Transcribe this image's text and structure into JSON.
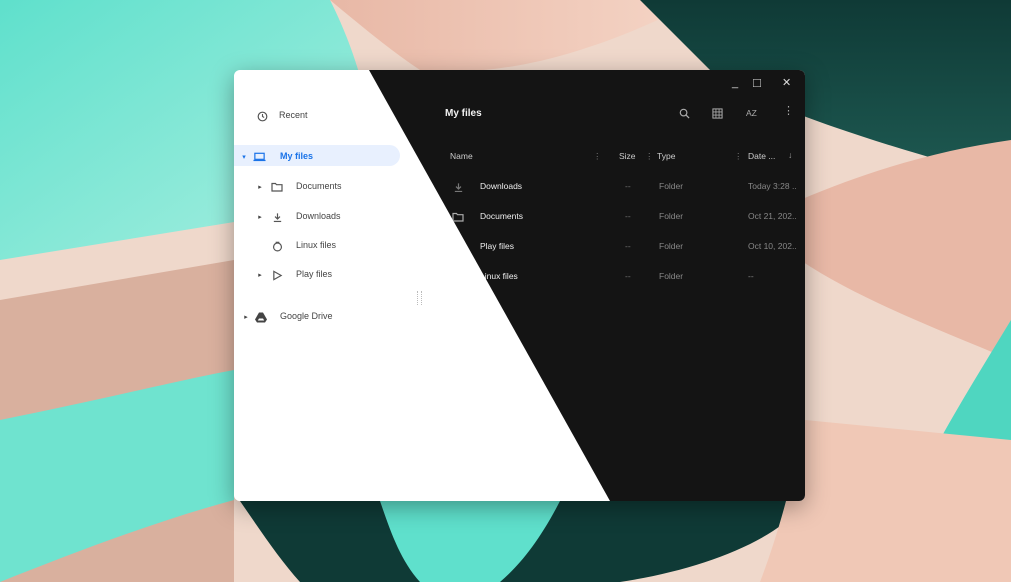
{
  "sidebar": {
    "recent": "Recent",
    "my_files": "My files",
    "documents": "Documents",
    "downloads": "Downloads",
    "linux_files": "Linux files",
    "play_files": "Play files",
    "google_drive": "Google Drive"
  },
  "main": {
    "title": "My files",
    "columns": {
      "name": "Name",
      "size": "Size",
      "type": "Type",
      "date": "Date ..."
    },
    "sort_label": "AZ",
    "rows": [
      {
        "name": "Downloads",
        "size": "--",
        "type": "Folder",
        "date": "Today 3:28 ..",
        "icon": "download-icon"
      },
      {
        "name": "Documents",
        "size": "--",
        "type": "Folder",
        "date": "Oct 21, 202..",
        "icon": "folder-icon"
      },
      {
        "name": "Play files",
        "size": "--",
        "type": "Folder",
        "date": "Oct 10, 202..",
        "icon": "play-icon"
      },
      {
        "name": "Linux files",
        "size": "--",
        "type": "Folder",
        "date": "--",
        "icon": "linux-icon"
      }
    ]
  },
  "window_controls": {
    "minimize": "_",
    "maximize": "□",
    "close": "✕"
  },
  "colors": {
    "accent": "#1a73e8",
    "selected_bg": "#e8f0fe",
    "dark_bg": "#141414",
    "light_bg": "#ffffff"
  }
}
